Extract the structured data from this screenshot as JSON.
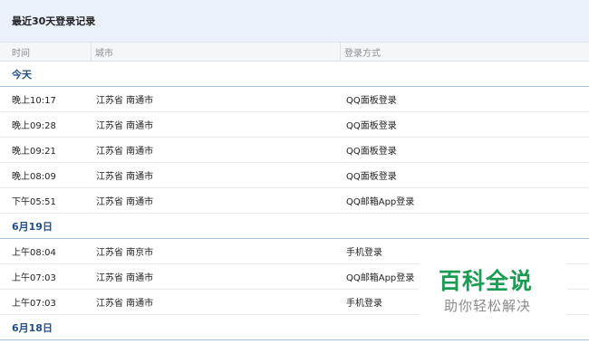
{
  "panel": {
    "title": "最近30天登录记录"
  },
  "columns": {
    "time": "时间",
    "city": "城市",
    "method": "登录方式"
  },
  "groups": [
    {
      "label": "今天",
      "rows": [
        {
          "time": "晚上10:17",
          "city": "江苏省 南通市",
          "method": "QQ面板登录"
        },
        {
          "time": "晚上09:28",
          "city": "江苏省 南通市",
          "method": "QQ面板登录"
        },
        {
          "time": "晚上09:21",
          "city": "江苏省 南通市",
          "method": "QQ面板登录"
        },
        {
          "time": "晚上08:09",
          "city": "江苏省 南通市",
          "method": "QQ面板登录"
        },
        {
          "time": "下午05:51",
          "city": "江苏省 南通市",
          "method": "QQ邮箱App登录"
        }
      ]
    },
    {
      "label": "6月19日",
      "rows": [
        {
          "time": "上午08:04",
          "city": "江苏省 南京市",
          "method": "手机登录"
        },
        {
          "time": "上午07:03",
          "city": "江苏省 南通市",
          "method": "QQ邮箱App登录"
        },
        {
          "time": "上午07:03",
          "city": "江苏省 南通市",
          "method": "手机登录"
        }
      ]
    },
    {
      "label": "6月18日",
      "rows": []
    }
  ],
  "watermark": {
    "main": "百科全说",
    "sub": "助你轻松解决"
  }
}
